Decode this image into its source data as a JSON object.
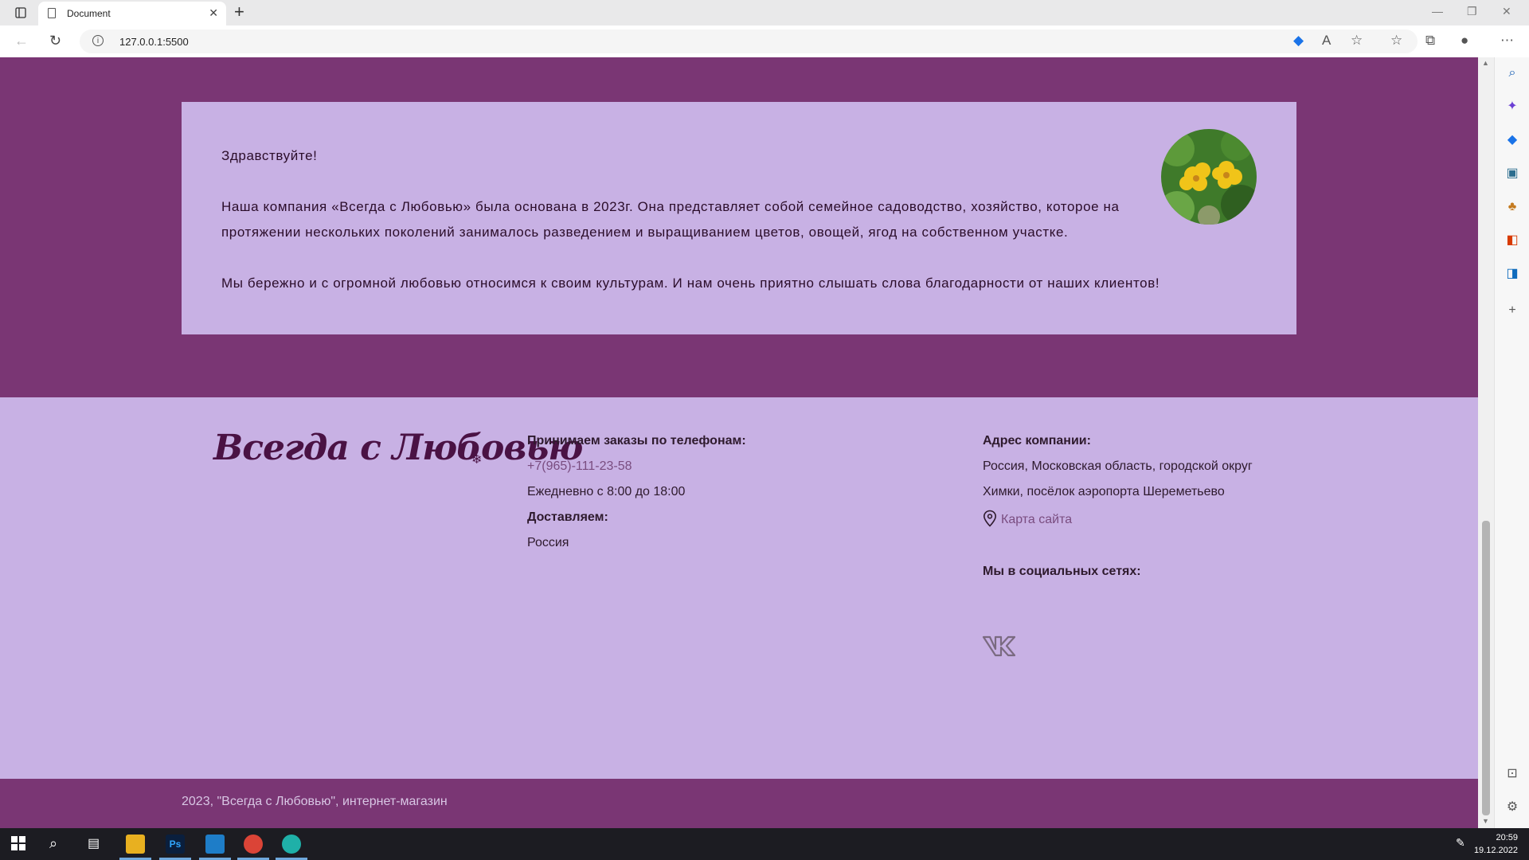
{
  "browser": {
    "tab_title": "Document",
    "url": "127.0.0.1:5500"
  },
  "about": {
    "greeting": "Здравствуйте!",
    "paragraph1": "Наша компания «Всегда с Любовью» была основана в 2023г. Она представляет собой семейное садоводство, хозяйство, которое на протяжении нескольких поколений занималось разведением и выращиванием цветов, овощей, ягод на собственном участке.",
    "paragraph2": "Мы бережно и с огромной любовью относимся к своим культурам. И нам очень приятно слышать слова благодарности от наших клиентов!"
  },
  "footer": {
    "logo": "Всегда с Любовью",
    "orders_heading": "Принимаем заказы по телефонам:",
    "phone": "+7(965)-111-23-58",
    "hours": "Ежедневно с 8:00 до 18:00",
    "delivery_heading": "Доставляем:",
    "delivery_region": "Россия",
    "address_heading": "Адрес компании:",
    "address_line1": "Россия, Московская область, городской округ",
    "address_line2": "Химки, посёлок аэропорта Шереметьево",
    "sitemap_link": "Карта сайта",
    "social_heading": "Мы в социальных сетях:"
  },
  "copyright": "2023, \"Всегда с Любовью\", интернет-магазин",
  "taskbar": {
    "time": "20:59",
    "date": "19.12.2022"
  },
  "colors": {
    "section_bg": "#7a3674",
    "card_bg": "#c8b1e4",
    "text_dark": "#2b0d2a",
    "link": "#7a4d80"
  }
}
